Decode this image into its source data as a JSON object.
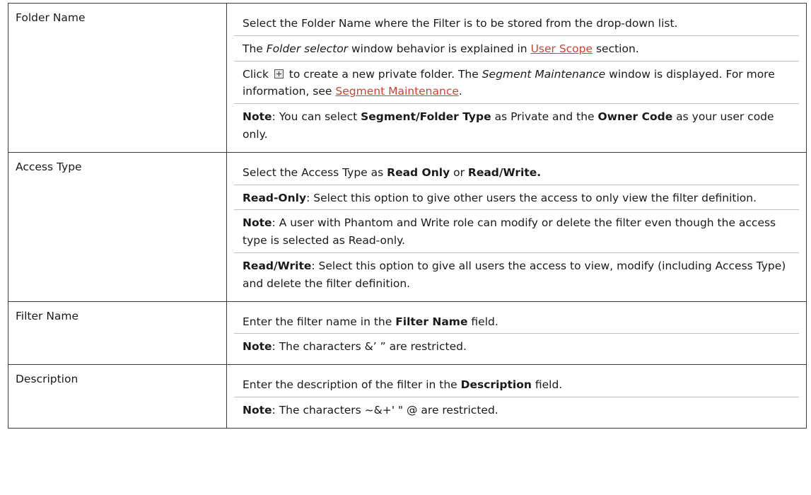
{
  "rows": [
    {
      "label": "Folder Name",
      "p1": "Select the Folder Name where the Filter is to be stored from the drop-down list.",
      "p2": {
        "a": "The ",
        "b": "Folder selector",
        "c": " window behavior is explained in ",
        "link": "User Scope",
        "d": " section."
      },
      "p3": {
        "a": "Click ",
        "icon": "new-folder-icon",
        "b": " to create a new private folder. The ",
        "c": "Segment Maintenance",
        "d": " window is displayed. For more information, see ",
        "link": "Segment Maintenance",
        "e": "."
      },
      "p4": {
        "a": "Note",
        "b": ": You can select ",
        "c": "Segment/Folder Type",
        "d": " as Private and the ",
        "e": "Owner Code",
        "f": " as your user code only."
      }
    },
    {
      "label": "Access Type",
      "p1": {
        "a": "Select the Access Type as ",
        "b": "Read Only",
        "c": " or ",
        "d": "Read/Write."
      },
      "p2": {
        "a": "Read-Only",
        "b": ": Select this option to give other users the access to only view the filter definition."
      },
      "p3": {
        "a": "Note",
        "b": ": A user with Phantom and Write role can modify or delete the filter even though the access type is selected as Read-only."
      },
      "p4": {
        "a": "Read/Write",
        "b": ": Select this option to give all users the access to view, modify (including Access Type) and delete the filter definition."
      }
    },
    {
      "label": "Filter Name",
      "p1": {
        "a": "Enter the filter name in the ",
        "b": "Filter Name",
        "c": " field."
      },
      "p2": {
        "a": "Note",
        "b": ": The characters &’ ” are restricted."
      }
    },
    {
      "label": "Description",
      "p1": {
        "a": "Enter the description of the filter in the ",
        "b": "Description",
        "c": " field."
      },
      "p2": {
        "a": "Note",
        "b": ": The characters ~&+' \" @ are restricted."
      }
    }
  ]
}
